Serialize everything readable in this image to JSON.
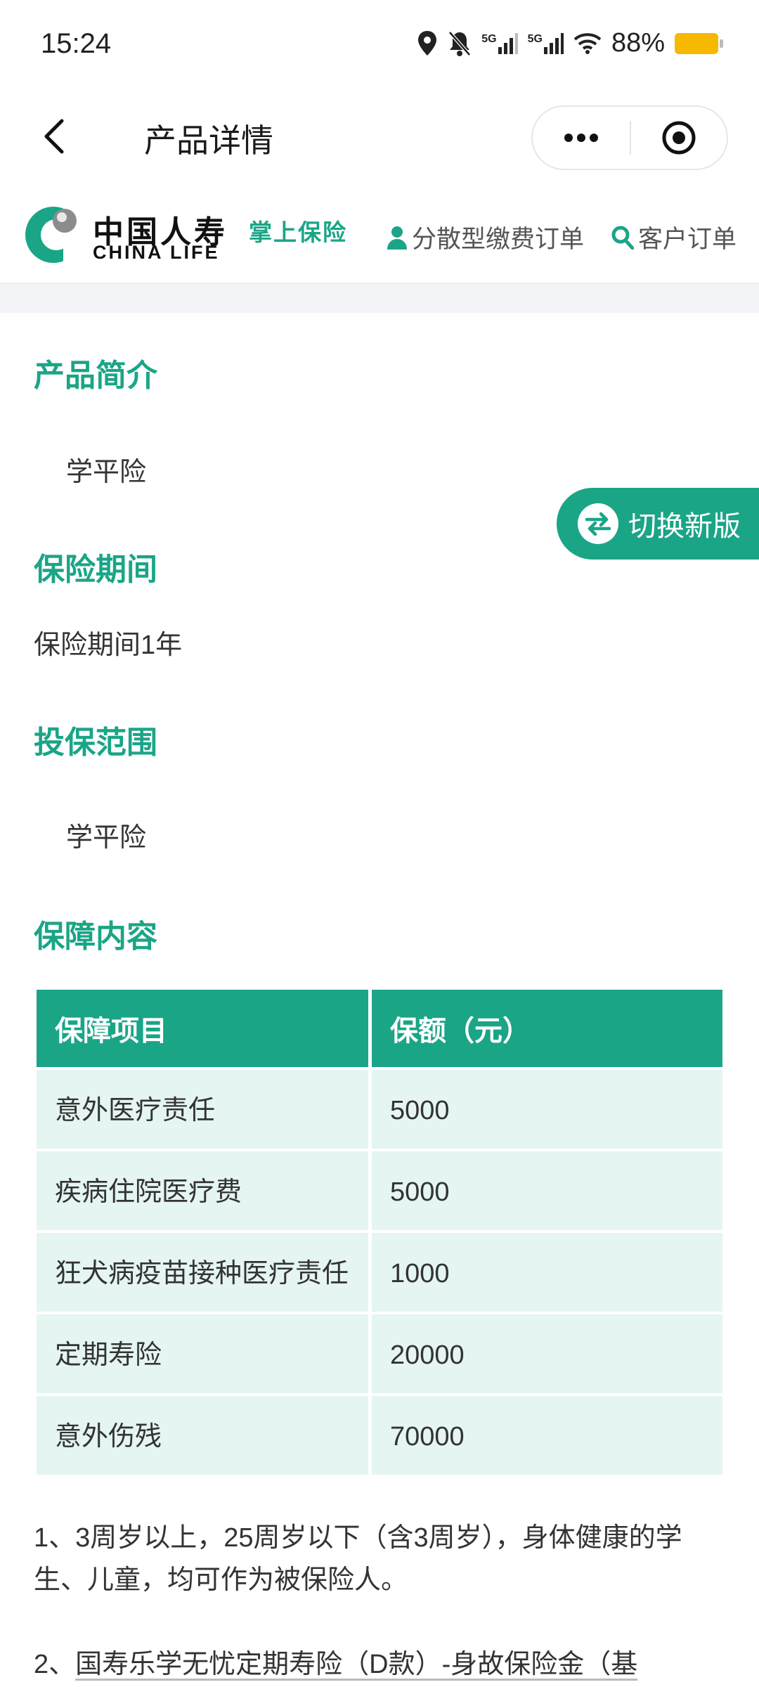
{
  "status_bar": {
    "time": "15:24",
    "signal1_label": "5G",
    "signal2_label": "5G",
    "battery_percent": "88%"
  },
  "header": {
    "title": "产品详情"
  },
  "brand": {
    "name_cn": "中国人寿",
    "name_en": "CHINA LIFE",
    "slogan": "掌上保险",
    "nav_orders": "分散型缴费订单",
    "nav_customer": "客户订单"
  },
  "sections": {
    "intro_title": "产品简介",
    "intro_text": "学平险",
    "period_title": "保险期间",
    "period_text": "保险期间1年",
    "scope_title": "投保范围",
    "scope_text": "学平险",
    "coverage_title": "保障内容"
  },
  "switch_button": {
    "label": "切换新版"
  },
  "coverage_table": {
    "headers": [
      "保障项目",
      "保额（元）"
    ],
    "rows": [
      {
        "item": "意外医疗责任",
        "amount": "5000"
      },
      {
        "item": "疾病住院医疗费",
        "amount": "5000"
      },
      {
        "item": "狂犬病疫苗接种医疗责任",
        "amount": "1000"
      },
      {
        "item": "定期寿险",
        "amount": "20000"
      },
      {
        "item": "意外伤残",
        "amount": "70000"
      }
    ]
  },
  "notes": {
    "note1": "1、3周岁以上，25周岁以下（含3周岁），身体健康的学生、儿童，均可作为被保险人。",
    "note2_prefix": "2、",
    "note2_link": "国寿乐学无忧定期寿险（D款）-身故保险金（基"
  }
}
